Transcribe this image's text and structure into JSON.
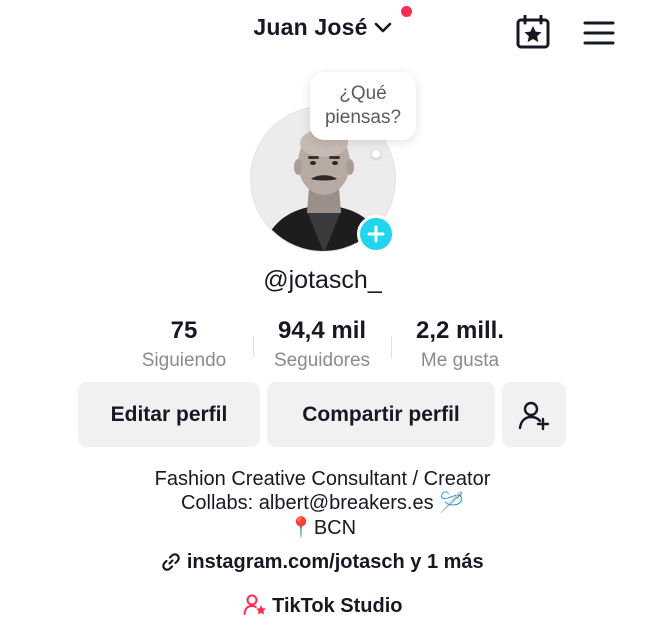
{
  "header": {
    "username": "Juan José",
    "icons": {
      "dropdown": "chevron-down-icon",
      "calendar": "calendar-star-icon",
      "menu": "hamburger-menu-icon"
    },
    "notification_color": "#fe2c55"
  },
  "profile": {
    "bubble_text": "¿Qué piensas?",
    "handle": "@jotasch_",
    "add_badge_color": "#20d5ec"
  },
  "stats": [
    {
      "value": "75",
      "label": "Siguiendo"
    },
    {
      "value": "94,4 mil",
      "label": "Seguidores"
    },
    {
      "value": "2,2 mill.",
      "label": "Me gusta"
    }
  ],
  "actions": {
    "edit_label": "Editar perfil",
    "share_label": "Compartir perfil",
    "add_friend_icon": "add-friend-icon"
  },
  "bio": {
    "line1": "Fashion Creative Consultant / Creator",
    "line2": "Collabs: albert@breakers.es",
    "line2_emoji": "🪡",
    "line3_emoji": "📍",
    "line3": "BCN"
  },
  "link": {
    "text": "instagram.com/jotasch",
    "suffix": "y 1 más"
  },
  "studio": {
    "label": "TikTok Studio",
    "accent": "#fe2c55"
  }
}
